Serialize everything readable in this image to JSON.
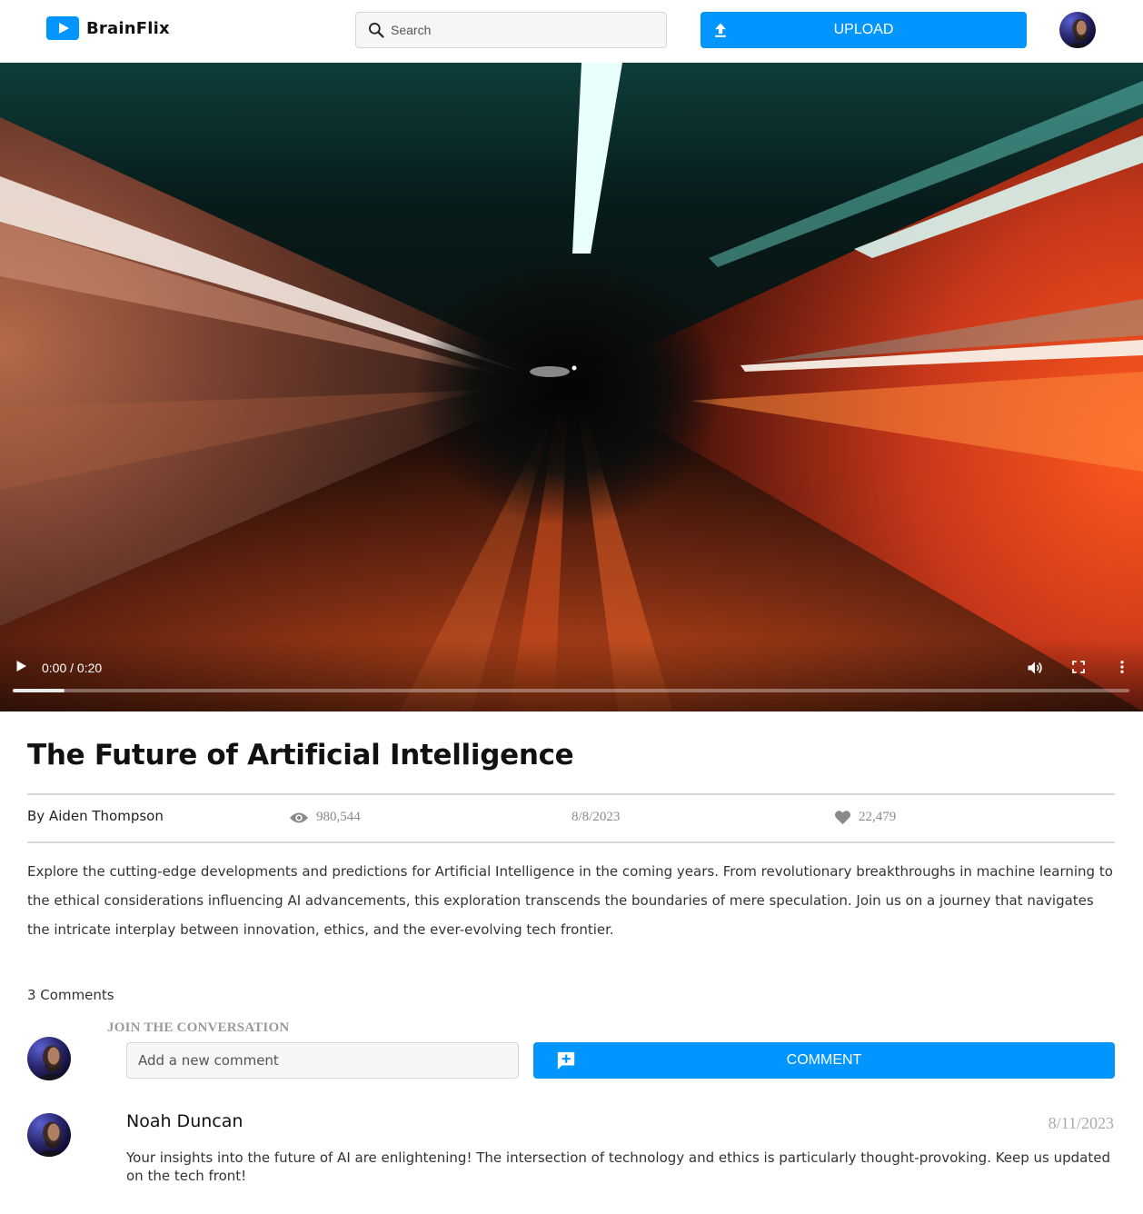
{
  "header": {
    "brand": "BrainFlix",
    "search_placeholder": "Search",
    "upload_label": "UPLOAD"
  },
  "video": {
    "time": "0:00 / 0:20",
    "progress_percent": 4.6
  },
  "details": {
    "title": "The Future of Artificial Intelligence",
    "author": "By Aiden Thompson",
    "views": "980,544",
    "date": "8/8/2023",
    "likes": "22,479",
    "description": "Explore the cutting-edge developments and predictions for Artificial Intelligence in the coming years. From revolutionary breakthroughs in machine learning to the ethical considerations influencing AI advancements, this exploration transcends the boundaries of mere speculation. Join us on a journey that navigates the intricate interplay between innovation, ethics, and the ever-evolving tech frontier."
  },
  "comments": {
    "count_label": "3 Comments",
    "join_label": "JOIN THE CONVERSATION",
    "input_placeholder": "Add a new comment",
    "button_label": "COMMENT",
    "items": [
      {
        "author": "Noah Duncan",
        "date": "8/11/2023",
        "text": "Your insights into the future of AI are enlightening! The intersection of technology and ethics is particularly thought-provoking. Keep us updated on the tech front!"
      }
    ]
  },
  "icons": {
    "logo": "play-logo-icon",
    "search": "search-icon",
    "upload": "upload-icon",
    "play": "play-icon",
    "volume": "volume-icon",
    "fullscreen": "fullscreen-icon",
    "more": "more-vertical-icon",
    "views": "eye-icon",
    "likes": "heart-icon",
    "add_comment": "add-comment-icon"
  },
  "colors": {
    "accent": "#0095ff",
    "meta_text": "#8a8a8a"
  }
}
